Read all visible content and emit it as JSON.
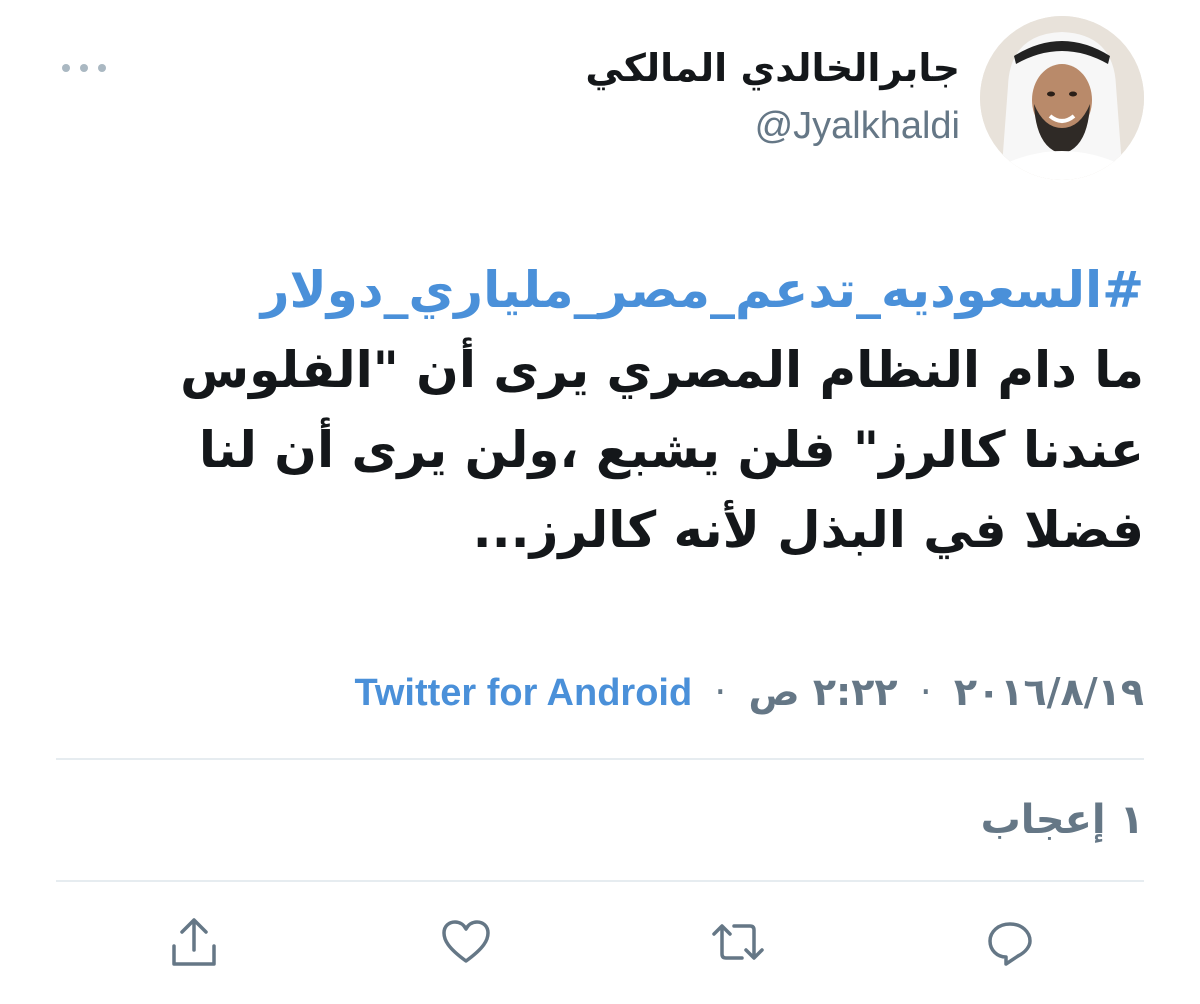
{
  "author": {
    "display_name": "جابرالخالدي المالكي",
    "handle": "@Jyalkhaldi"
  },
  "tweet": {
    "hashtag": "#السعوديه_تدعم_مصر_ملياري_دولار",
    "lines": [
      "ما دام النظام المصري يرى أن \"الفلوس",
      "عندنا كالرز\" فلن يشبع ،ولن يرى أن لنا",
      "فضلا في البذل لأنه كالرز..."
    ]
  },
  "meta": {
    "date": "٢٠١٦/٨/١٩",
    "time": "٢:٢٢ ص",
    "separator": "·",
    "source": "Twitter for Android"
  },
  "engagement": {
    "likes_label": "١ إعجاب"
  },
  "icons": {
    "more": "more-dots-icon",
    "reply": "reply-icon",
    "retweet": "retweet-icon",
    "like": "heart-icon",
    "share": "share-icon"
  },
  "colors": {
    "link": "#4a90d9",
    "secondary": "#657786",
    "icon": "#657786",
    "divider": "#e6ecf0"
  }
}
